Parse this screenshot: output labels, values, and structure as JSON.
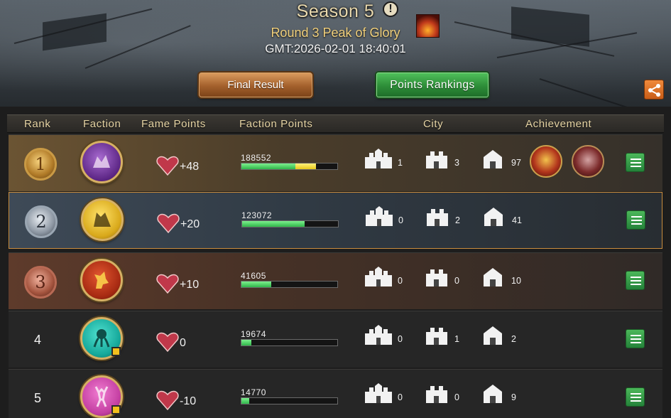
{
  "header": {
    "season_title": "Season 5",
    "round_title": "Round 3 Peak of Glory",
    "gmt_time": "GMT:2026-02-01 18:40:01",
    "final_result_label": "Final Result",
    "points_rankings_label": "Points Rankings",
    "info_icon": "info-icon",
    "share_icon": "share-icon"
  },
  "table": {
    "columns": {
      "rank": "Rank",
      "faction": "Faction",
      "fame_points": "Fame Points",
      "faction_points": "Faction Points",
      "city": "City",
      "achievement": "Achievement"
    },
    "rows": [
      {
        "rank": "1",
        "faction_color": "#5b2584",
        "fame": "+48",
        "faction_points": "188552",
        "progress": 0.72,
        "progress_yellow": 0.2,
        "city_large": "1",
        "city_medium": "3",
        "city_small": "97",
        "achievements": 2
      },
      {
        "rank": "2",
        "faction_color": "#d9a91b",
        "fame": "+20",
        "faction_points": "123072",
        "progress": 0.65,
        "progress_yellow": 0,
        "city_large": "0",
        "city_medium": "2",
        "city_small": "41",
        "achievements": 0
      },
      {
        "rank": "3",
        "faction_color": "#a72a12",
        "fame": "+10",
        "faction_points": "41605",
        "progress": 0.31,
        "progress_yellow": 0,
        "city_large": "0",
        "city_medium": "0",
        "city_small": "10",
        "achievements": 0
      },
      {
        "rank": "4",
        "faction_color": "#15a89a",
        "fame": "0",
        "faction_points": "19674",
        "progress": 0.1,
        "progress_yellow": 0,
        "city_large": "0",
        "city_medium": "1",
        "city_small": "2",
        "achievements": 0
      },
      {
        "rank": "5",
        "faction_color": "#c43fa2",
        "fame": "-10",
        "faction_points": "14770",
        "progress": 0.08,
        "progress_yellow": 0,
        "city_large": "0",
        "city_medium": "0",
        "city_small": "9",
        "achievements": 0
      }
    ]
  },
  "colors": {
    "progress_green": "#2fb64a",
    "progress_yellow": "#e7c91a",
    "header_text": "#e8d6a6",
    "button_green": "#2d8d38",
    "button_orange": "#a3602c"
  }
}
